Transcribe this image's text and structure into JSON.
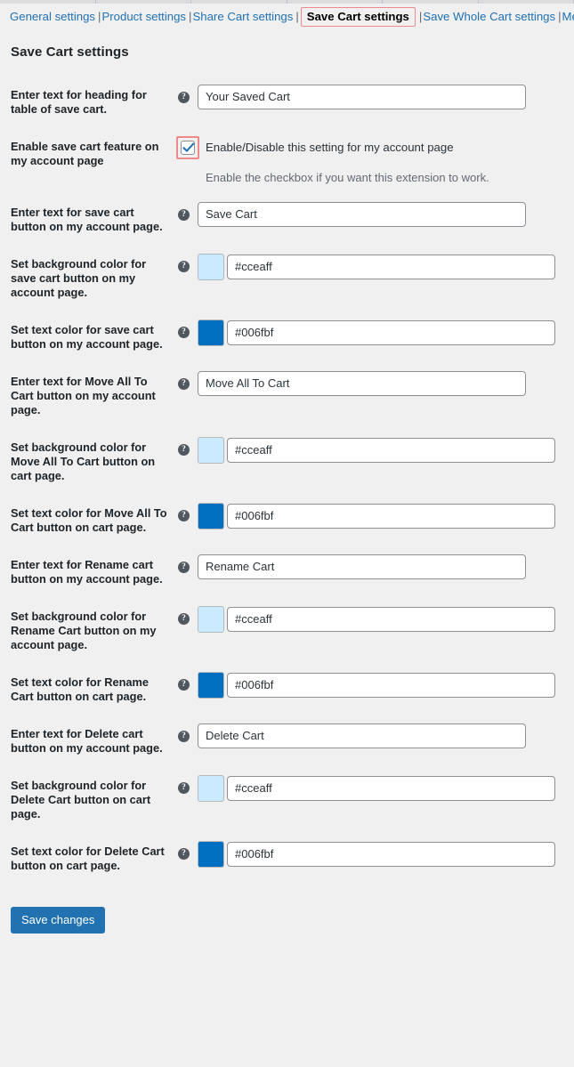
{
  "nav": {
    "items": [
      {
        "label": "General settings",
        "current": false
      },
      {
        "label": "Product settings",
        "current": false
      },
      {
        "label": "Share Cart settings",
        "current": false
      },
      {
        "label": "Save Cart settings",
        "current": true
      },
      {
        "label": "Save Whole Cart settings",
        "current": false
      },
      {
        "label": "Messages",
        "current": false
      }
    ],
    "separator": "|"
  },
  "page": {
    "title": "Save Cart settings"
  },
  "icons": {
    "help": "?"
  },
  "settings": [
    {
      "label": "Enter text for heading for table of save cart.",
      "type": "text",
      "value": "Your Saved Cart",
      "help": "?"
    },
    {
      "label": "Enable save cart feature on my account page",
      "type": "checkbox",
      "checked": true,
      "checkbox_label": "Enable/Disable this setting for my account page",
      "description": "Enable the checkbox if you want this extension to work."
    },
    {
      "label": "Enter text for save cart button on my account page.",
      "type": "text",
      "value": "Save Cart",
      "help": "?"
    },
    {
      "label": "Set background color for save cart button on my account page.",
      "type": "color",
      "value": "#cceaff",
      "swatch": "#cceaff",
      "help": "?"
    },
    {
      "label": "Set text color for save cart button on my account page.",
      "type": "color",
      "value": "#006fbf",
      "swatch": "#006fbf",
      "help": "?"
    },
    {
      "label": "Enter text for Move All To Cart button on my account page.",
      "type": "text",
      "value": "Move All To Cart",
      "help": "?"
    },
    {
      "label": "Set background color for Move All To Cart button on cart page.",
      "type": "color",
      "value": "#cceaff",
      "swatch": "#cceaff",
      "help": "?"
    },
    {
      "label": "Set text color for Move All To Cart button on cart page.",
      "type": "color",
      "value": "#006fbf",
      "swatch": "#006fbf",
      "help": "?"
    },
    {
      "label": "Enter text for Rename cart button on my account page.",
      "type": "text",
      "value": "Rename Cart",
      "help": "?"
    },
    {
      "label": "Set background color for Rename Cart button on my account page.",
      "type": "color",
      "value": "#cceaff",
      "swatch": "#cceaff",
      "help": "?"
    },
    {
      "label": "Set text color for Rename Cart button on cart page.",
      "type": "color",
      "value": "#006fbf",
      "swatch": "#006fbf",
      "help": "?"
    },
    {
      "label": "Enter text for Delete cart button on my account page.",
      "type": "text",
      "value": "Delete Cart",
      "help": "?"
    },
    {
      "label": "Set background color for Delete Cart button on cart page.",
      "type": "color",
      "value": "#cceaff",
      "swatch": "#cceaff",
      "help": "?"
    },
    {
      "label": "Set text color for Delete Cart button on cart page.",
      "type": "color",
      "value": "#006fbf",
      "swatch": "#006fbf",
      "help": "?"
    }
  ],
  "submit": {
    "label": "Save changes"
  },
  "colors": {
    "accent": "#2271b1",
    "link": "#2271b1",
    "highlight_border": "#f08a8a",
    "page_bg": "#f0f0f1",
    "swatch_light": "#cceaff",
    "swatch_dark": "#006fbf"
  }
}
